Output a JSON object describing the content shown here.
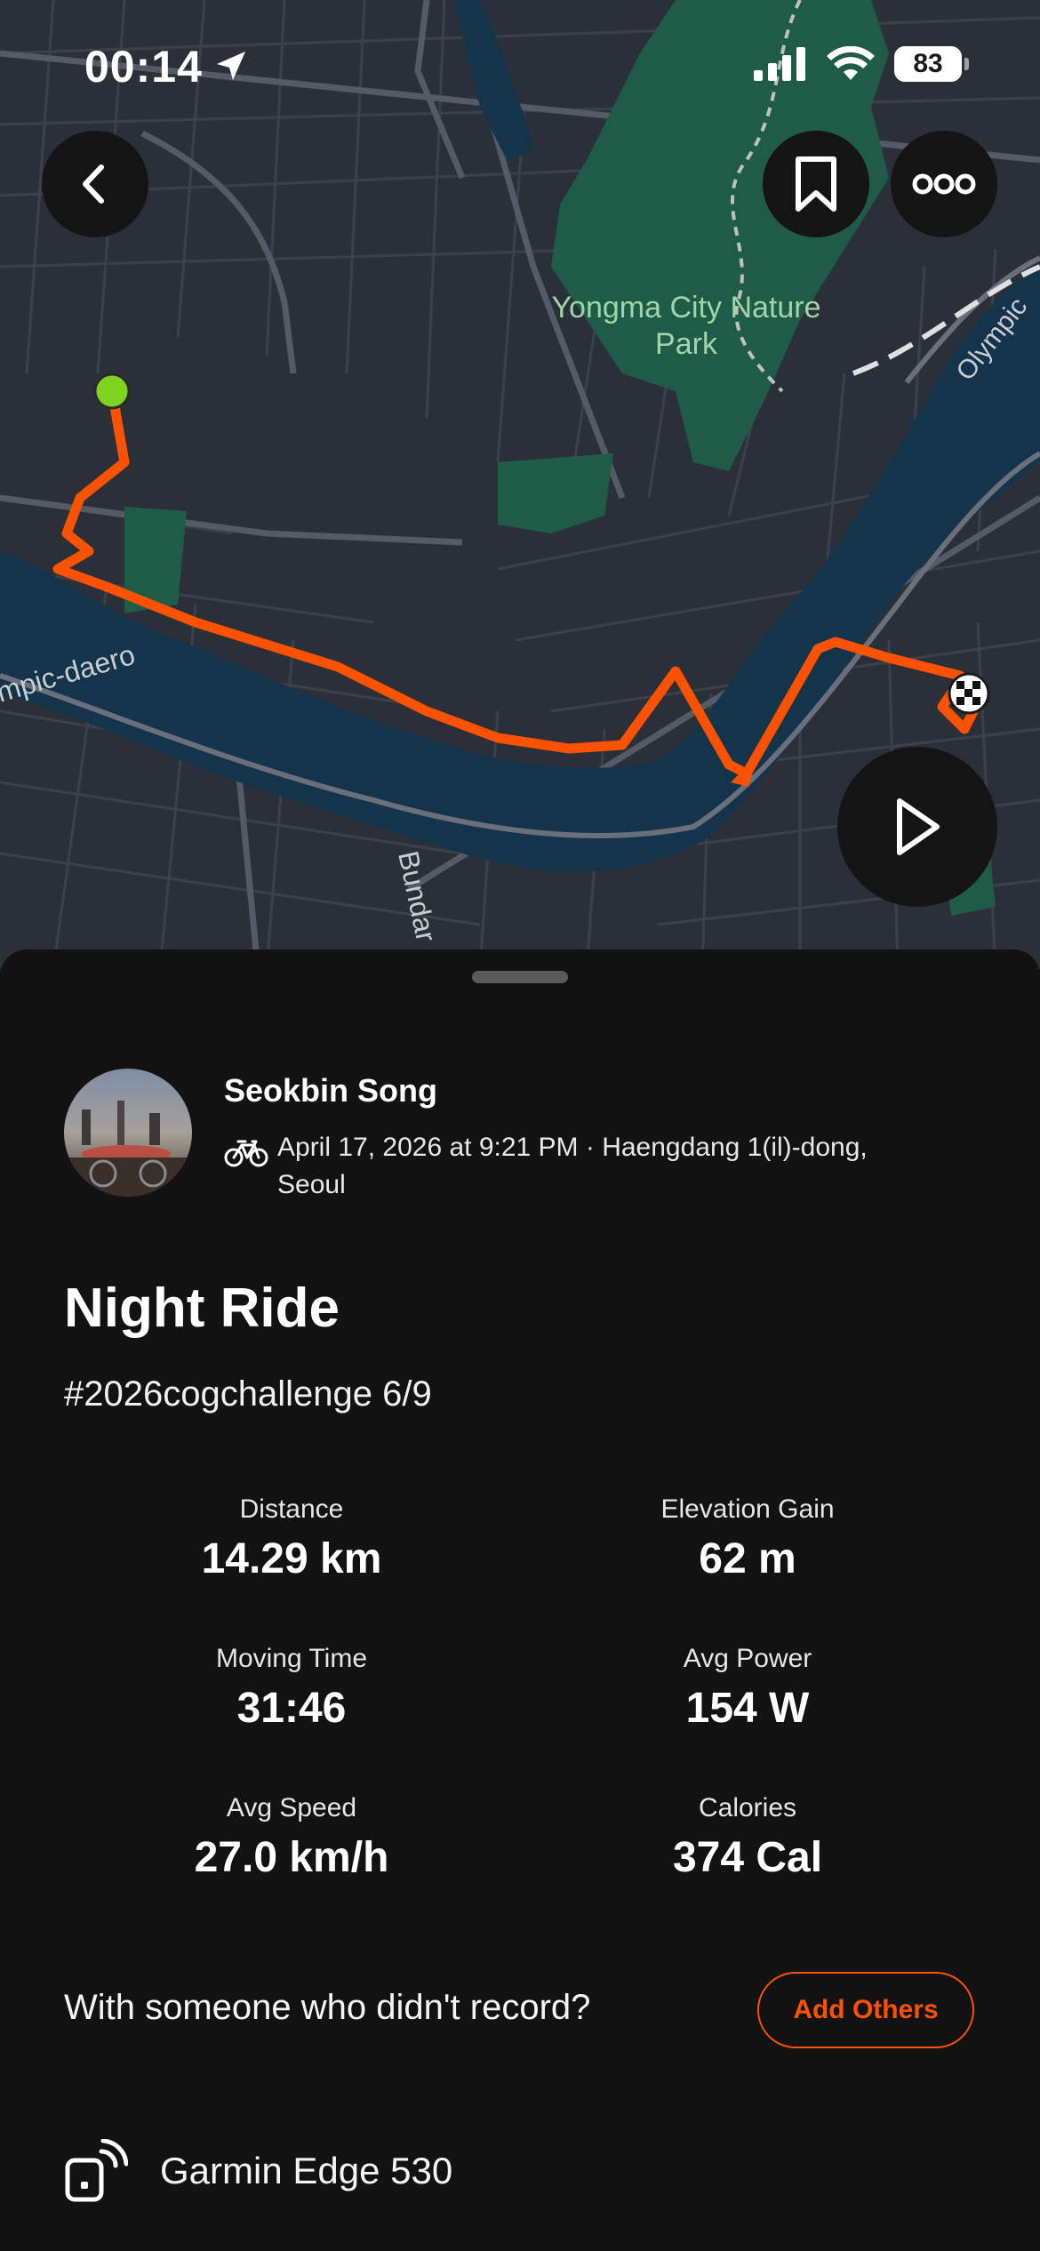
{
  "status_bar": {
    "time": "00:14",
    "battery": "83",
    "battery_level": 0.83
  },
  "map": {
    "labels": {
      "park": "Yongma City Nature",
      "park_line2": "Park",
      "olympic_left": "mpic-daero",
      "olympic_right": "Olympic",
      "bundang": "Bundar"
    },
    "route_color": "#fc5200",
    "start_color": "#7ed321"
  },
  "toolbar": {
    "back_icon": "chevron-left-icon",
    "bookmark_icon": "bookmark-icon",
    "more_icon": "more-icon",
    "play_icon": "play-icon"
  },
  "athlete": {
    "name": "Seokbin Song",
    "meta": "April 17, 2026 at 9:21 PM · Haengdang 1(il)-dong, Seoul",
    "sport_icon": "bike-icon"
  },
  "activity": {
    "title": "Night Ride",
    "description": "#2026cogchallenge 6/9"
  },
  "stats": [
    {
      "label": "Distance",
      "value": "14.29 km"
    },
    {
      "label": "Elevation Gain",
      "value": "62 m"
    },
    {
      "label": "Moving Time",
      "value": "31:46"
    },
    {
      "label": "Avg Power",
      "value": "154 W"
    },
    {
      "label": "Avg Speed",
      "value": "27.0 km/h"
    },
    {
      "label": "Calories",
      "value": "374 Cal"
    }
  ],
  "others": {
    "prompt": "With someone who didn't record?",
    "button_label": "Add Others"
  },
  "device": {
    "icon": "device-signal-icon",
    "name": "Garmin Edge 530"
  },
  "colors": {
    "accent": "#fc5200",
    "background": "#121212",
    "map_water": "#13344a",
    "map_park": "#1f5c47"
  }
}
